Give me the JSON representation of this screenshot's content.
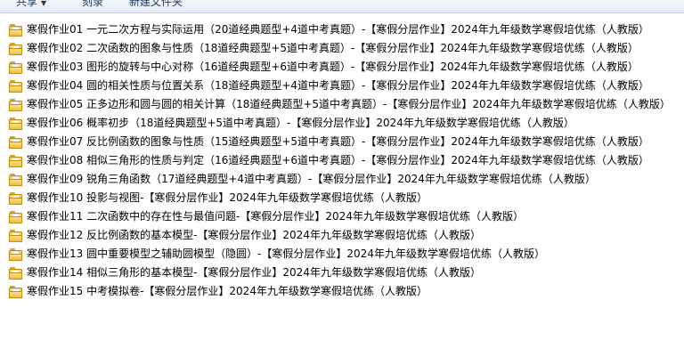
{
  "toolbar": {
    "share_label": "共享",
    "burn_label": "刻录",
    "new_folder_label": "新建文件夹",
    "share_caret": "▼"
  },
  "files": [
    {
      "name": "寒假作业01 一元二次方程与实际运用（20道经典题型+4道中考真题）-【寒假分层作业】2024年九年级数学寒假培优练（人教版）",
      "icon": "folder-icon"
    },
    {
      "name": "寒假作业02 二次函数的图象与性质（18道经典题型+5道中考真题）-【寒假分层作业】2024年九年级数学寒假培优练（人教版）",
      "icon": "folder-icon"
    },
    {
      "name": "寒假作业03 图形的旋转与中心对称（16道经典题型+6道中考真题）-【寒假分层作业】2024年九年级数学寒假培优练（人教版）",
      "icon": "folder-icon"
    },
    {
      "name": "寒假作业04 圆的相关性质与位置关系（18道经典题型+4道中考真题）-【寒假分层作业】2024年九年级数学寒假培优练（人教版）",
      "icon": "folder-icon"
    },
    {
      "name": "寒假作业05 正多边形和圆与圆的相关计算（18道经典题型+5道中考真题）-【寒假分层作业】2024年九年级数学寒假培优练（人教版）",
      "icon": "folder-icon"
    },
    {
      "name": "寒假作业06 概率初步（18道经典题型+5道中考真题）-【寒假分层作业】2024年九年级数学寒假培优练（人教版）",
      "icon": "folder-icon"
    },
    {
      "name": "寒假作业07 反比例函数的图象与性质（15道经典题型+5道中考真题）-【寒假分层作业】2024年九年级数学寒假培优练（人教版）",
      "icon": "folder-icon"
    },
    {
      "name": "寒假作业08 相似三角形的性质与判定（16道经典题型+6道中考真题）-【寒假分层作业】2024年九年级数学寒假培优练（人教版）",
      "icon": "folder-icon"
    },
    {
      "name": "寒假作业09 锐角三角函数（17道经典题型+4道中考真题）-【寒假分层作业】2024年九年级数学寒假培优练（人教版）",
      "icon": "folder-icon"
    },
    {
      "name": "寒假作业10 投影与视图-【寒假分层作业】2024年九年级数学寒假培优练（人教版）",
      "icon": "folder-icon"
    },
    {
      "name": "寒假作业11 二次函数中的存在性与最值问题-【寒假分层作业】2024年九年级数学寒假培优练（人教版）",
      "icon": "folder-icon"
    },
    {
      "name": "寒假作业12 反比例函数的基本模型-【寒假分层作业】2024年九年级数学寒假培优练（人教版）",
      "icon": "folder-icon"
    },
    {
      "name": "寒假作业13 圆中重要模型之辅助圆模型（隐圆）-【寒假分层作业】2024年九年级数学寒假培优练（人教版）",
      "icon": "folder-icon"
    },
    {
      "name": "寒假作业14 相似三角形的基本模型-【寒假分层作业】2024年九年级数学寒假培优练（人教版）",
      "icon": "folder-icon"
    },
    {
      "name": "寒假作业15 中考模拟卷-【寒假分层作业】2024年九年级数学寒假培优练（人教版）",
      "icon": "folder-icon"
    }
  ]
}
